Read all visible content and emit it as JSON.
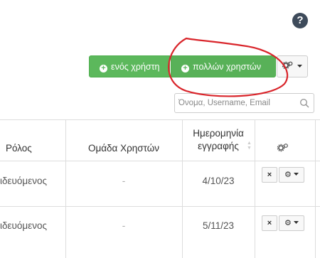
{
  "help": {
    "label": "?"
  },
  "toolbar": {
    "add_one_label": "ενός χρήστη",
    "add_many_label": "πολλών χρηστών",
    "plus_glyph": "+",
    "settings_glyph": "⚙"
  },
  "search": {
    "placeholder": "Όνομα, Username, Email"
  },
  "table": {
    "headers": {
      "role": "Ρόλος",
      "group": "Ομάδα Χρηστών",
      "reg_date_line1": "Ημερομηνία",
      "reg_date_line2": "εγγραφής",
      "actions_icon": "gears-icon"
    },
    "rows": [
      {
        "role": "ιδευόμενος",
        "group": "-",
        "date": "4/10/23"
      },
      {
        "role": "ιδευόμενος",
        "group": "-",
        "date": "5/11/23"
      }
    ],
    "delete_glyph": "×",
    "row_gear_glyph": "⚙"
  },
  "colors": {
    "primary_green": "#5cb85c",
    "annotation_red": "#d9252b",
    "help_icon": "#3e4b5b"
  }
}
